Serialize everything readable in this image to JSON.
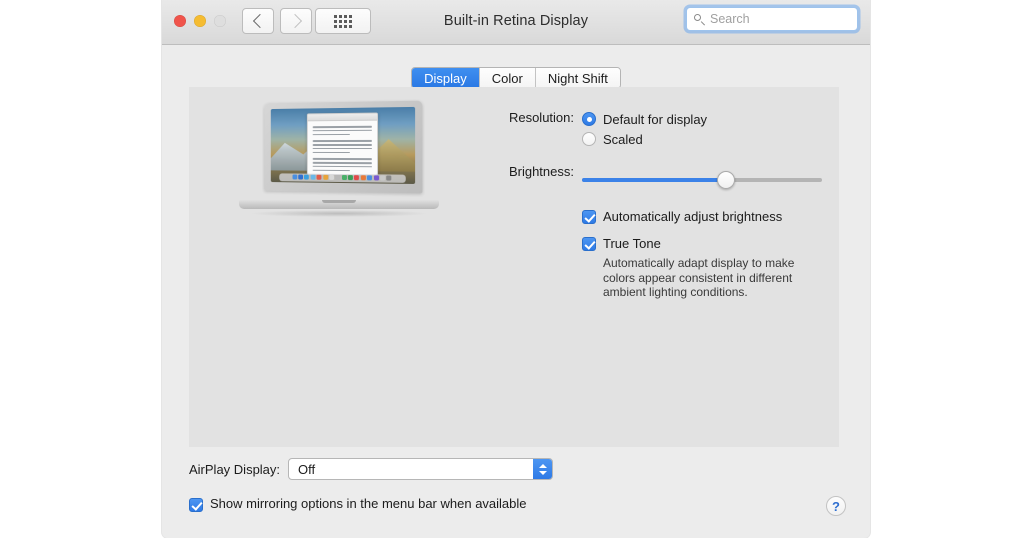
{
  "window": {
    "title": "Built-in Retina Display",
    "traffic_lights": [
      {
        "name": "close",
        "color": "#f0544b"
      },
      {
        "name": "minimize",
        "color": "#f5bc32"
      },
      {
        "name": "zoom",
        "color": "#dedede"
      }
    ],
    "nav": {
      "back_icon": "chevron-left-icon",
      "forward_icon": "chevron-right-icon",
      "grid_icon": "show-all-grid-icon"
    },
    "search": {
      "placeholder": "Search",
      "value": "",
      "icon": "search-icon",
      "focused": true,
      "focus_ring_color": "#6ea8ed"
    }
  },
  "tabs": [
    {
      "label": "Display",
      "selected": true
    },
    {
      "label": "Color",
      "selected": false
    },
    {
      "label": "Night Shift",
      "selected": false
    }
  ],
  "preview": {
    "device": "macbook-pro-illustration",
    "wallpaper": "high-sierra"
  },
  "resolution": {
    "label": "Resolution:",
    "options": [
      {
        "label": "Default for display",
        "selected": true
      },
      {
        "label": "Scaled",
        "selected": false
      }
    ]
  },
  "brightness": {
    "label": "Brightness:",
    "value_percent": 60
  },
  "checkboxes": [
    {
      "label": "Automatically adjust brightness",
      "checked": true
    },
    {
      "label": "True Tone",
      "checked": true
    }
  ],
  "true_tone_description": "Automatically adapt display to make colors appear consistent in different ambient lighting conditions.",
  "airplay": {
    "label": "AirPlay Display:",
    "value": "Off",
    "stepper_icon": "chevron-up-down-icon"
  },
  "mirroring": {
    "label": "Show mirroring options in the menu bar when available",
    "checked": true
  },
  "help": {
    "label": "?",
    "icon": "help-icon",
    "color": "#2f6fd0"
  },
  "colors": {
    "accent": "#2e7ae6",
    "tab_active": "#3f8ff0",
    "panel_bg": "#e2e2e2",
    "window_bg": "#ececec"
  }
}
